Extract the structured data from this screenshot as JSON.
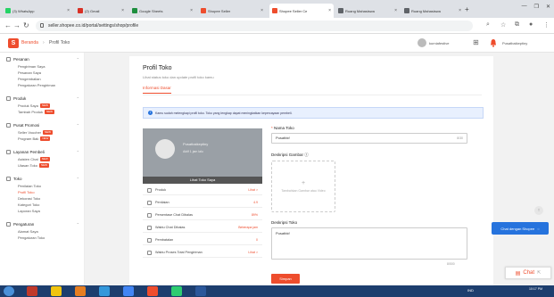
{
  "browser": {
    "tabs": [
      {
        "label": "(3) WhatsApp",
        "color": "#25d366",
        "active": false
      },
      {
        "label": "(2) Gmail",
        "color": "#d93025",
        "active": false
      },
      {
        "label": "Google Sheets",
        "color": "#1e8e3e",
        "active": false
      },
      {
        "label": "Shopee Seller",
        "color": "#ee4d2d",
        "active": false
      },
      {
        "label": "Shopee Seller Ce",
        "color": "#ee4d2d",
        "active": true
      },
      {
        "label": "Ruang Mahasiswa",
        "color": "#5f6368",
        "active": false
      },
      {
        "label": "Ruang Mahasiswa",
        "color": "#5f6368",
        "active": false
      }
    ],
    "url": "seller.shopee.co.id/portal/settings/shop/profile"
  },
  "header": {
    "brand": "Beranda",
    "breadcrumb": "Profil Toko",
    "username": "kurniafestive",
    "shop_name": "Pusatbaikeptiny"
  },
  "sidebar": {
    "sections": [
      {
        "title": "Pesanan",
        "items": [
          {
            "label": "Pengiriman Saya"
          },
          {
            "label": "Pesanan Saya"
          },
          {
            "label": "Pengembalian"
          },
          {
            "label": "Pengaturan Pengiriman"
          }
        ]
      },
      {
        "title": "Produk",
        "items": [
          {
            "label": "Produk Saya",
            "badge": "NEW"
          },
          {
            "label": "Tambah Produk",
            "badge": "NEW"
          }
        ]
      },
      {
        "title": "Pusat Promosi",
        "items": [
          {
            "label": "Seller Voucher",
            "badge": "NEW"
          },
          {
            "label": "Program Bak",
            "badge": "NEW"
          }
        ]
      },
      {
        "title": "Layanan Pembeli",
        "items": [
          {
            "label": "Asisten Chat",
            "badge": "NEW"
          },
          {
            "label": "Ulasan Toko",
            "badge": "NEW"
          }
        ]
      },
      {
        "title": "Toko",
        "items": [
          {
            "label": "Penilaian Toko"
          },
          {
            "label": "Profil Toko",
            "active": true
          },
          {
            "label": "Dekorasi Toko"
          },
          {
            "label": "Kategori Toko"
          },
          {
            "label": "Laporan Saya"
          }
        ]
      },
      {
        "title": "Pengaturan",
        "items": [
          {
            "label": "Alamat Saya"
          },
          {
            "label": "Pengaturan Toko"
          }
        ]
      }
    ]
  },
  "main": {
    "title": "Profil Toko",
    "subtitle": "Lihat status toko dan update profil toko kamu",
    "tab": "Informasi Dasar",
    "info": "Kamu sudah melengkapi profil toko. Toko yang lengkap dapat meningkatkan kepercayaan pembeli.",
    "preview": {
      "shop": "Pusatbaikeptiny",
      "info": "Aktif 1 jam lalu",
      "button": "Lihat Toko Saya"
    },
    "stats": [
      {
        "label": "Produk",
        "value": "Lihat >"
      },
      {
        "label": "Penilaian",
        "value": "4.9"
      },
      {
        "label": "Persentase Chat Dibalas",
        "value": "89%"
      },
      {
        "label": "Waktu Chat Dibalas",
        "value": "Beberapa jam"
      },
      {
        "label": "Pembatalan",
        "value": "0"
      },
      {
        "label": "Waktu Proses Total Pengiriman",
        "value": "Lihat >"
      }
    ],
    "name_label": "Nama Toko",
    "name_value": "Pusatbkf",
    "name_count": "8/30",
    "media_label": "Deskripsi Gambar",
    "media_upload": "Tambahkan Gambar atau Video",
    "desc_label": "Deskripsi Toko",
    "desc_value": "Pusatbkf",
    "desc_count": "8/500",
    "save": "Simpan"
  },
  "overlay": {
    "chat_bubble": "Chat dengan Shopee",
    "chat_widget": "Chat"
  },
  "taskbar": {
    "apps": [
      "#c0392b",
      "#f1c40f",
      "#e67e22",
      "#3498db",
      "#4285f4",
      "#ee4d2d",
      "#2ecc71",
      "#2b579a"
    ],
    "tray": "IND",
    "time": "10:17 PM"
  }
}
